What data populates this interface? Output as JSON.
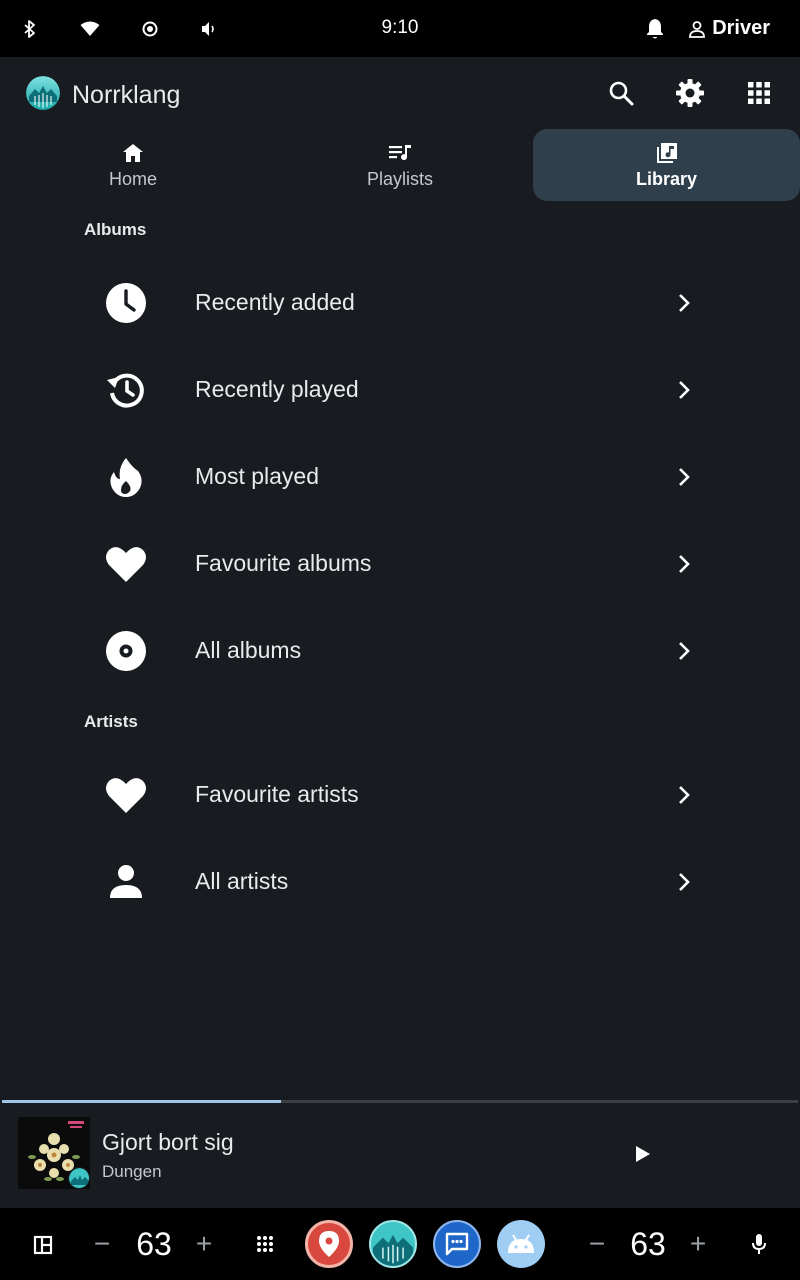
{
  "status_bar": {
    "time": "9:10",
    "user": "Driver",
    "icons": [
      "bluetooth-icon",
      "wifi-icon",
      "brightness-icon",
      "volume-icon",
      "notification-icon",
      "person-icon"
    ]
  },
  "app_bar": {
    "title": "Norrklang",
    "actions": [
      "search-icon",
      "settings-icon",
      "apps-grid-icon"
    ]
  },
  "tabs": [
    {
      "label": "Home",
      "icon": "home-icon",
      "active": false
    },
    {
      "label": "Playlists",
      "icon": "playlist-icon",
      "active": false
    },
    {
      "label": "Library",
      "icon": "library-icon",
      "active": true
    }
  ],
  "library": {
    "albums_title": "Albums",
    "albums": [
      {
        "label": "Recently added",
        "icon": "clock-icon"
      },
      {
        "label": "Recently played",
        "icon": "history-icon"
      },
      {
        "label": "Most played",
        "icon": "fire-icon"
      },
      {
        "label": "Favourite albums",
        "icon": "heart-icon"
      },
      {
        "label": "All albums",
        "icon": "disc-icon"
      }
    ],
    "artists_title": "Artists",
    "artists": [
      {
        "label": "Favourite artists",
        "icon": "heart-icon"
      },
      {
        "label": "All artists",
        "icon": "person-icon"
      }
    ]
  },
  "now_playing": {
    "title": "Gjort bort sig",
    "artist": "Dungen",
    "progress_fraction": 0.35,
    "accent": "#9fc4e8"
  },
  "system_bar": {
    "left_temp": "63",
    "right_temp": "63",
    "minus": "−",
    "plus": "+",
    "dock_apps": [
      "maps-app-icon",
      "norrklang-app-icon",
      "messages-app-icon",
      "android-app-icon"
    ]
  },
  "colors": {
    "background": "#181b1f",
    "active_tab": "#2f3f4b",
    "text": "#e8eaed"
  }
}
